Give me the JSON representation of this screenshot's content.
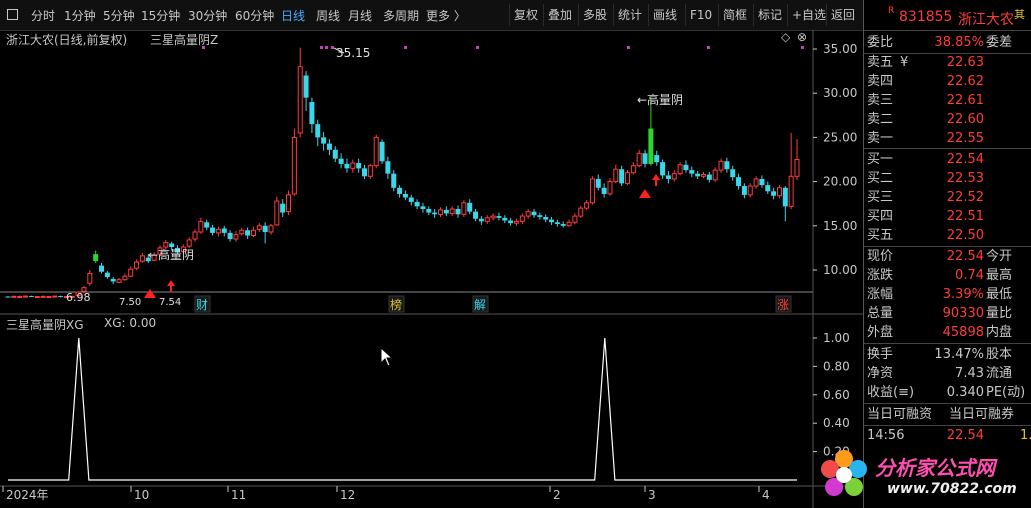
{
  "toolbar": {
    "collapse_icon": "panel-toggle-icon",
    "periods": [
      "分时",
      "1分钟",
      "5分钟",
      "15分钟",
      "30分钟",
      "60分钟",
      "日线",
      "周线",
      "月线",
      "多周期",
      "更多 〉"
    ],
    "active_period": "日线",
    "right_buttons": [
      "复权",
      "叠加",
      "多股",
      "统计",
      "画线",
      "F10",
      "简框",
      "标记",
      "+自选",
      "返回"
    ]
  },
  "main_chart": {
    "title": "浙江大农(日线,前复权)",
    "indicator": "三星高量阴Z",
    "y_ticks": [
      "35.00",
      "30.00",
      "25.00",
      "20.00",
      "15.00",
      "10.00"
    ],
    "annotations": {
      "high": "35.15",
      "low": "6.98",
      "label_high_vol_1": "←高量阴",
      "label_high_vol_2": "←高量阴",
      "low2": "7.50",
      "low3": "7.54"
    },
    "event_markers": [
      "财",
      "榜",
      "解",
      "涨"
    ]
  },
  "sub_chart": {
    "title": "三星高量阴XG",
    "value_label": "XG: 0.00",
    "y_ticks": [
      "1.00",
      "0.80",
      "0.60",
      "0.40",
      "0.20"
    ]
  },
  "x_axis": [
    "2024年",
    "10",
    "11",
    "12",
    "2",
    "3",
    "4"
  ],
  "chart_data": {
    "type": "line",
    "title": "三星高量阴XG",
    "series": [
      {
        "name": "XG",
        "values": [
          0,
          0,
          0,
          0,
          0,
          0,
          0,
          1,
          0,
          0,
          0,
          0,
          0,
          0,
          0,
          0,
          0,
          0,
          0,
          0,
          0,
          0,
          0,
          0,
          0,
          0,
          0,
          0,
          0,
          0,
          0,
          0,
          0,
          0,
          0,
          0,
          0,
          0,
          0,
          0,
          0,
          0,
          0,
          0,
          0,
          0,
          0,
          0,
          0,
          0,
          0,
          0,
          0,
          0,
          0,
          0,
          0,
          0,
          0,
          1,
          0,
          0,
          0,
          0,
          0,
          0,
          0,
          0,
          0,
          0,
          0,
          0,
          0,
          0,
          0,
          0,
          0,
          0,
          0
        ]
      }
    ],
    "ylim": [
      0,
      1
    ]
  },
  "quote": {
    "code": "831855",
    "name": "浙江大农",
    "r_badge": "R",
    "wei_bi_label": "委比",
    "wei_bi": "38.85%",
    "wei_cha_label": "委差",
    "sell": [
      {
        "label": "卖五",
        "price": "22.63"
      },
      {
        "label": "卖四",
        "price": "22.62"
      },
      {
        "label": "卖三",
        "price": "22.61"
      },
      {
        "label": "卖二",
        "price": "22.60"
      },
      {
        "label": "卖一",
        "price": "22.55"
      }
    ],
    "sell_yen": "¥",
    "buy": [
      {
        "label": "买一",
        "price": "22.54"
      },
      {
        "label": "买二",
        "price": "22.53"
      },
      {
        "label": "买三",
        "price": "22.52"
      },
      {
        "label": "买四",
        "price": "22.51"
      },
      {
        "label": "买五",
        "price": "22.50"
      }
    ],
    "stats": [
      {
        "l1": "现价",
        "v1": "22.54",
        "l2": "今开"
      },
      {
        "l1": "涨跌",
        "v1": "0.74",
        "l2": "最高"
      },
      {
        "l1": "涨幅",
        "v1": "3.39%",
        "l2": "最低"
      },
      {
        "l1": "总量",
        "v1": "90330",
        "l2": "量比"
      },
      {
        "l1": "外盘",
        "v1": "45898",
        "l2": "内盘"
      }
    ],
    "stats2": [
      {
        "l1": "换手",
        "v1": "13.47%",
        "l2": "股本"
      },
      {
        "l1": "净资",
        "v1": "7.43",
        "l2": "流通"
      },
      {
        "l1": "收益(≡)",
        "v1": "0.340",
        "l2": "PE(动)"
      }
    ],
    "margin_label_1": "当日可融资",
    "margin_label_2": "当日可融券",
    "ticks": [
      {
        "time": "14:56",
        "price": "22.54",
        "vol": "1."
      }
    ],
    "cut_label": "其"
  },
  "watermark": {
    "text": "分析家公式网",
    "url": "www.70822.com"
  },
  "colors": {
    "up": "#ff3b3b",
    "down": "#3ad6ea",
    "highlight": "#2bd62b",
    "axis": "#c8c8c8",
    "accent": "#4aa8ff"
  }
}
